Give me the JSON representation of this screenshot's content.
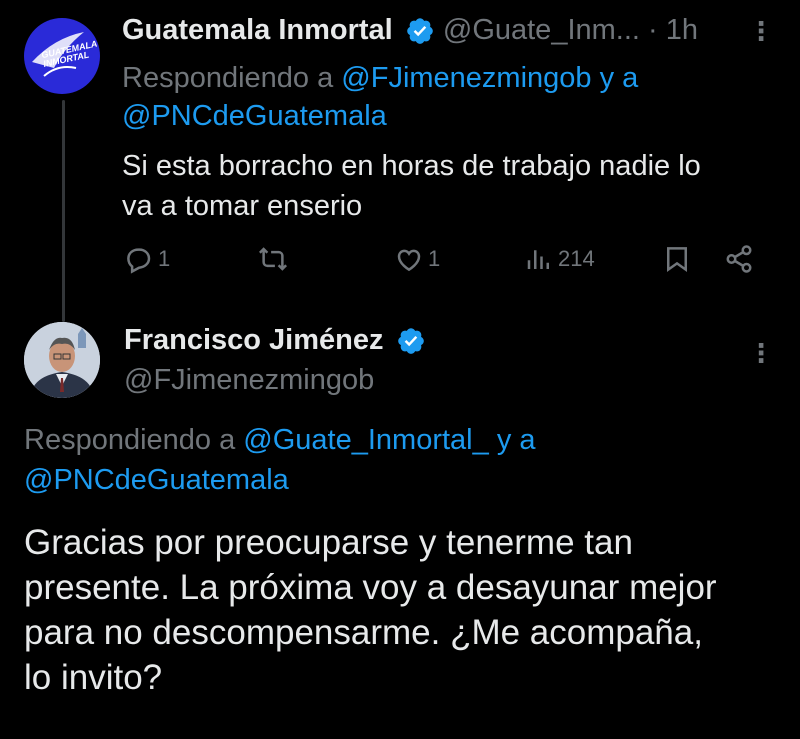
{
  "tweet1": {
    "author_name": "Guatemala Inmortal",
    "handle": "@Guate_Inm...",
    "time": "· 1h",
    "avatar_text": "GUATEMALA INMORTAL",
    "replying_prefix": "Respondiendo a",
    "replying_to_1": "@FJimenezmingob",
    "replying_and": "y a",
    "replying_to_2": "@PNCdeGuatemala",
    "text_line1": "Si esta borracho en horas de trabajo nadie lo",
    "text_line2": "va a tomar enserio",
    "actions": {
      "replies": "1",
      "retweets": "",
      "likes": "1",
      "views": "214"
    }
  },
  "tweet2": {
    "author_name": "Francisco Jiménez",
    "handle": "@FJimenezmingob",
    "replying_prefix": "Respondiendo a",
    "replying_to_1": "@Guate_Inmortal_",
    "replying_and": "y a",
    "replying_to_2": "@PNCdeGuatemala",
    "text_line1": "Gracias por preocuparse y tenerme tan",
    "text_line2": "presente. La próxima voy a desayunar mejor",
    "text_line3": "para no descompensarme. ¿Me acompaña,",
    "text_line4": "lo invito?"
  },
  "colors": {
    "background": "#000000",
    "text": "#e7e9ea",
    "muted": "#71767b",
    "link": "#1d9bf0",
    "verified": "#1d9bf0"
  }
}
